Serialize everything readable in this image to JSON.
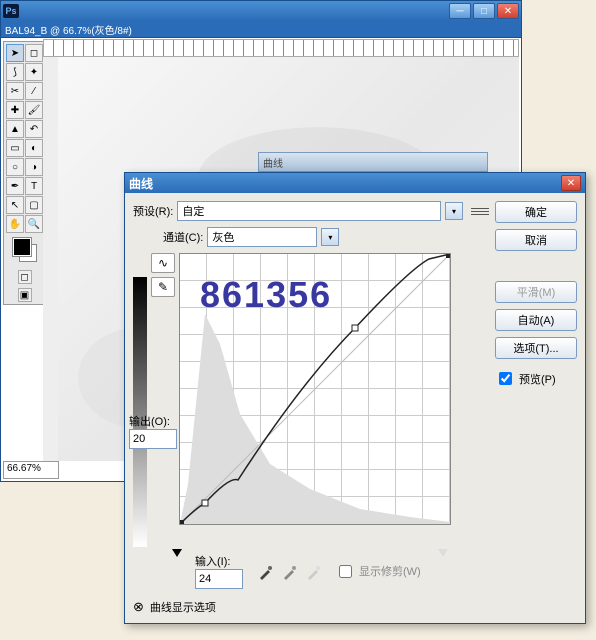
{
  "main_window": {
    "app_icon": "Ps",
    "doc_tab": "BAL94_B @ 66.7%(灰色/8#)",
    "zoom": "66.67%"
  },
  "ghost_title": "曲线",
  "dialog": {
    "title": "曲线",
    "preset_label": "预设(R):",
    "preset_value": "自定",
    "channel_label": "通道(C):",
    "channel_value": "灰色",
    "output_label": "输出(O):",
    "output_value": "20",
    "input_label": "输入(I):",
    "input_value": "24",
    "show_clip_label": "显示修剪(W)",
    "expand_label": "曲线显示选项",
    "buttons": {
      "ok": "确定",
      "cancel": "取消",
      "smooth": "平滑(M)",
      "auto": "自动(A)",
      "options": "选项(T)...",
      "preview": "预览(P)"
    }
  },
  "watermark": "861356",
  "chart_data": {
    "type": "line",
    "title": "曲线",
    "xlabel": "输入",
    "ylabel": "输出",
    "xlim": [
      0,
      255
    ],
    "ylim": [
      0,
      255
    ],
    "series": [
      {
        "name": "baseline",
        "points": [
          [
            0,
            0
          ],
          [
            255,
            255
          ]
        ]
      },
      {
        "name": "curve",
        "points": [
          [
            0,
            0
          ],
          [
            24,
            20
          ],
          [
            55,
            42
          ],
          [
            165,
            185
          ],
          [
            235,
            250
          ],
          [
            255,
            255
          ]
        ]
      }
    ],
    "control_points": [
      [
        24,
        20
      ],
      [
        165,
        185
      ]
    ],
    "histogram_peak_input": 30
  }
}
